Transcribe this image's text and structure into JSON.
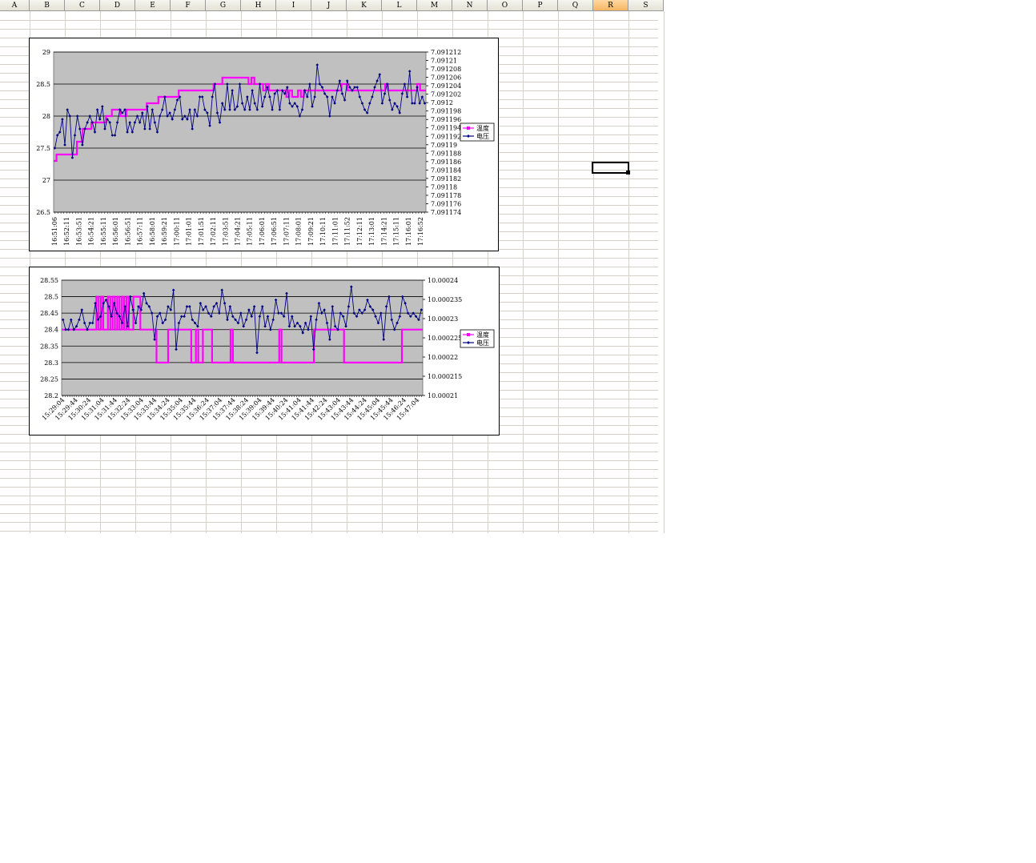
{
  "spreadsheet": {
    "columns": [
      "A",
      "B",
      "C",
      "D",
      "E",
      "F",
      "G",
      "H",
      "I",
      "J",
      "K",
      "L",
      "M",
      "N",
      "O",
      "P",
      "Q",
      "R",
      "S"
    ],
    "selected_column": "R",
    "active_cell": "R10"
  },
  "charts": [
    {
      "legend": [
        "温度",
        "电压"
      ],
      "left_axis": {
        "min": 26.5,
        "max": 29,
        "ticks": [
          "29",
          "28.5",
          "28",
          "27.5",
          "27",
          "26.5"
        ]
      },
      "right_axis": {
        "ticks": [
          "7.091212",
          "7.09121",
          "7.091208",
          "7.091206",
          "7.091204",
          "7.091202",
          "7.0912",
          "7.091198",
          "7.091196",
          "7.091194",
          "7.091192",
          "7.09119",
          "7.091188",
          "7.091186",
          "7.091184",
          "7.091182",
          "7.09118",
          "7.091178",
          "7.091176",
          "7.091174"
        ]
      },
      "x_labels": [
        "16:51:06",
        "16:52:11",
        "16:53:51",
        "16:54:21",
        "16:55:11",
        "16:56:01",
        "16:56:51",
        "16:57:11",
        "16:58:01",
        "16:59:21",
        "17:00:11",
        "17:01:01",
        "17:01:51",
        "17:02:11",
        "17:03:51",
        "17:04:21",
        "17:05:11",
        "17:06:01",
        "17:06:51",
        "17:07:11",
        "17:08:01",
        "17:09:21",
        "17:10:11",
        "17:11:01",
        "17:11:52",
        "17:12:11",
        "17:13:01",
        "17:14:21",
        "17:15:11",
        "17:16:01",
        "17:16:52"
      ]
    },
    {
      "legend": [
        "温度",
        "电压"
      ],
      "left_axis": {
        "min": 28.2,
        "max": 28.55,
        "ticks": [
          "28.55",
          "28.5",
          "28.45",
          "28.4",
          "28.35",
          "28.3",
          "28.25",
          "28.2"
        ]
      },
      "right_axis": {
        "ticks": [
          "10.00024",
          "10.000235",
          "10.00023",
          "10.000225",
          "10.00022",
          "10.000215",
          "10.00021"
        ]
      },
      "x_labels": [
        "15:29:04",
        "15:29:44",
        "15:30:24",
        "15:31:04",
        "15:31:44",
        "15:32:24",
        "15:33:04",
        "15:33:44",
        "15:34:24",
        "15:35:04",
        "15:35:44",
        "15:36:24",
        "15:37:04",
        "15:37:44",
        "15:38:24",
        "15:39:04",
        "15:39:44",
        "15:40:24",
        "15:41:04",
        "15:41:44",
        "15:42:24",
        "15:43:04",
        "15:43:44",
        "15:44:24",
        "15:45:04",
        "15:45:44",
        "15:46:24",
        "15:47:04"
      ]
    }
  ],
  "chart_data": [
    {
      "type": "line",
      "series": [
        {
          "name": "温度",
          "axis": "left",
          "color": "#ff00ff",
          "marker": "square",
          "values": [
            27.3,
            27.4,
            27.4,
            27.4,
            27.4,
            27.4,
            27.4,
            27.4,
            27.6,
            27.6,
            27.8,
            27.8,
            27.8,
            27.9,
            27.9,
            27.9,
            27.9,
            27.9,
            28.0,
            28.0,
            28.1,
            28.1,
            28.1,
            28.0,
            28.0,
            28.1,
            28.1,
            28.1,
            28.1,
            28.1,
            28.1,
            28.1,
            28.2,
            28.2,
            28.2,
            28.2,
            28.3,
            28.3,
            28.3,
            28.3,
            28.3,
            28.3,
            28.3,
            28.4,
            28.4,
            28.4,
            28.4,
            28.4,
            28.4,
            28.4,
            28.4,
            28.4,
            28.4,
            28.4,
            28.4,
            28.5,
            28.5,
            28.5,
            28.6,
            28.6,
            28.6,
            28.6,
            28.6,
            28.6,
            28.6,
            28.6,
            28.6,
            28.5,
            28.6,
            28.5,
            28.5,
            28.5,
            28.4,
            28.5,
            28.4,
            28.4,
            28.4,
            28.4,
            28.4,
            28.4,
            28.3,
            28.4,
            28.3,
            28.3,
            28.4,
            28.3,
            28.4,
            28.4,
            28.4,
            28.4,
            28.4,
            28.4,
            28.4,
            28.4,
            28.4,
            28.4,
            28.4,
            28.4,
            28.4,
            28.5,
            28.5,
            28.4,
            28.4,
            28.4,
            28.4,
            28.4,
            28.4,
            28.4,
            28.4,
            28.4,
            28.4,
            28.4,
            28.4,
            28.4,
            28.5,
            28.4,
            28.4,
            28.4,
            28.4,
            28.4,
            28.4,
            28.4,
            28.4,
            28.4,
            28.4,
            28.5,
            28.4,
            28.4
          ]
        },
        {
          "name": "电压",
          "axis": "left",
          "color": "#000080",
          "marker": "diamond",
          "values": [
            27.5,
            27.7,
            27.75,
            27.95,
            27.55,
            28.1,
            28.0,
            27.35,
            27.7,
            28.0,
            27.8,
            27.55,
            27.8,
            27.9,
            28.0,
            27.9,
            27.75,
            28.1,
            27.95,
            28.15,
            27.8,
            27.95,
            27.9,
            27.7,
            27.7,
            27.9,
            28.1,
            28.05,
            28.1,
            27.75,
            27.9,
            27.75,
            27.9,
            28.0,
            27.9,
            28.05,
            27.8,
            28.15,
            27.8,
            28.1,
            27.9,
            27.75,
            28.0,
            28.1,
            28.3,
            28.0,
            28.05,
            27.95,
            28.1,
            28.25,
            28.3,
            27.95,
            28.0,
            27.95,
            28.1,
            27.8,
            28.1,
            28.0,
            28.3,
            28.3,
            28.1,
            28.05,
            27.85,
            28.3,
            28.5,
            28.05,
            27.9,
            28.2,
            28.1,
            28.5,
            28.1,
            28.4,
            28.1,
            28.15,
            28.5,
            28.2,
            28.1,
            28.3,
            28.1,
            28.4,
            28.2,
            28.1,
            28.5,
            28.15,
            28.3,
            28.45,
            28.3,
            28.1,
            28.35,
            28.4,
            28.1,
            28.4,
            28.35,
            28.45,
            28.2,
            28.15,
            28.2,
            28.15,
            28.0,
            28.1,
            28.4,
            28.3,
            28.5,
            28.15,
            28.3,
            28.8,
            28.5,
            28.45,
            28.35,
            28.3,
            28.0,
            28.3,
            28.2,
            28.4,
            28.55,
            28.35,
            28.25,
            28.55,
            28.45,
            28.4,
            28.45,
            28.45,
            28.3,
            28.2,
            28.1,
            28.05,
            28.2,
            28.3,
            28.45,
            28.55,
            28.65,
            28.2,
            28.35,
            28.5,
            28.25,
            28.1,
            28.2,
            28.15,
            28.05,
            28.35,
            28.5,
            28.3,
            28.7,
            28.2,
            28.2,
            28.45,
            28.2,
            28.3,
            28.2
          ]
        }
      ],
      "ylim_left": [
        26.5,
        29
      ],
      "ylim_right": [
        7.091174,
        7.091212
      ],
      "grid": true,
      "legend_position": "right"
    },
    {
      "type": "line",
      "series": [
        {
          "name": "温度",
          "axis": "left",
          "color": "#ff00ff",
          "marker": "square",
          "values": [
            28.4,
            28.4,
            28.4,
            28.4,
            28.4,
            28.4,
            28.4,
            28.4,
            28.4,
            28.4,
            28.4,
            28.4,
            28.4,
            28.4,
            28.4,
            28.5,
            28.4,
            28.5,
            28.4,
            28.4,
            28.5,
            28.4,
            28.5,
            28.4,
            28.5,
            28.4,
            28.5,
            28.4,
            28.5,
            28.4,
            28.4,
            28.5,
            28.5,
            28.5,
            28.4,
            28.4,
            28.4,
            28.4,
            28.4,
            28.4,
            28.4,
            28.3,
            28.3,
            28.3,
            28.3,
            28.3,
            28.4,
            28.4,
            28.4,
            28.4,
            28.4,
            28.4,
            28.4,
            28.4,
            28.4,
            28.4,
            28.3,
            28.3,
            28.4,
            28.3,
            28.3,
            28.4,
            28.4,
            28.4,
            28.4,
            28.3,
            28.3,
            28.3,
            28.3,
            28.3,
            28.3,
            28.3,
            28.3,
            28.4,
            28.3,
            28.3,
            28.3,
            28.3,
            28.3,
            28.3,
            28.3,
            28.3,
            28.3,
            28.3,
            28.3,
            28.3,
            28.3,
            28.3,
            28.3,
            28.3,
            28.3,
            28.3,
            28.3,
            28.3,
            28.4,
            28.3,
            28.3,
            28.3,
            28.3,
            28.3,
            28.3,
            28.3,
            28.3,
            28.3,
            28.3,
            28.3,
            28.3,
            28.3,
            28.3,
            28.4,
            28.4,
            28.4,
            28.4,
            28.4,
            28.4,
            28.4,
            28.4,
            28.4,
            28.4,
            28.4,
            28.4,
            28.4,
            28.3,
            28.3,
            28.3,
            28.3,
            28.3,
            28.3,
            28.3,
            28.3,
            28.3,
            28.3,
            28.3,
            28.3,
            28.3,
            28.3,
            28.3,
            28.3,
            28.3,
            28.3,
            28.3,
            28.3,
            28.3,
            28.3,
            28.3,
            28.3,
            28.3,
            28.4,
            28.4,
            28.4,
            28.4,
            28.4,
            28.4,
            28.4,
            28.4,
            28.4
          ]
        },
        {
          "name": "电压",
          "axis": "left",
          "color": "#000080",
          "marker": "diamond",
          "values": [
            28.43,
            28.4,
            28.4,
            28.43,
            28.4,
            28.41,
            28.43,
            28.46,
            28.42,
            28.4,
            28.42,
            28.42,
            28.48,
            28.43,
            28.44,
            28.48,
            28.49,
            28.47,
            28.44,
            28.48,
            28.45,
            28.44,
            28.42,
            28.47,
            28.41,
            28.5,
            28.46,
            28.42,
            28.47,
            28.46,
            28.51,
            28.48,
            28.47,
            28.45,
            28.37,
            28.44,
            28.45,
            28.42,
            28.43,
            28.47,
            28.46,
            28.52,
            28.34,
            28.42,
            28.44,
            28.44,
            28.47,
            28.47,
            28.43,
            28.42,
            28.41,
            28.48,
            28.46,
            28.47,
            28.45,
            28.44,
            28.47,
            28.48,
            28.45,
            28.52,
            28.48,
            28.43,
            28.47,
            28.44,
            28.43,
            28.42,
            28.45,
            28.41,
            28.43,
            28.46,
            28.44,
            28.47,
            28.33,
            28.44,
            28.47,
            28.41,
            28.44,
            28.4,
            28.43,
            28.49,
            28.45,
            28.45,
            28.44,
            28.51,
            28.41,
            28.44,
            28.41,
            28.42,
            28.41,
            28.39,
            28.42,
            28.4,
            28.44,
            28.34,
            28.43,
            28.48,
            28.45,
            28.46,
            28.42,
            28.37,
            28.47,
            28.41,
            28.4,
            28.45,
            28.44,
            28.41,
            28.47,
            28.53,
            28.45,
            28.44,
            28.46,
            28.45,
            28.46,
            28.49,
            28.47,
            28.46,
            28.44,
            28.42,
            28.45,
            28.37,
            28.47,
            28.5,
            28.43,
            28.4,
            28.42,
            28.44,
            28.5,
            28.48,
            28.45,
            28.44,
            28.45,
            28.44,
            28.43,
            28.46
          ]
        }
      ],
      "ylim_left": [
        28.2,
        28.55
      ],
      "ylim_right": [
        10.00021,
        10.00024
      ],
      "grid": true,
      "legend_position": "right"
    }
  ]
}
